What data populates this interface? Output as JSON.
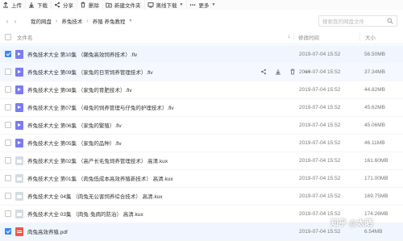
{
  "toolbar": {
    "items": [
      {
        "label": "上传",
        "icon": "upload-icon"
      },
      {
        "label": "下载",
        "icon": "download-icon"
      },
      {
        "label": "分享",
        "icon": "share-icon"
      },
      {
        "label": "删除",
        "icon": "delete-icon"
      },
      {
        "label": "新建文件夹",
        "icon": "new-folder-icon"
      },
      {
        "label": "离线下载",
        "icon": "offline-download-icon"
      },
      {
        "label": "更多",
        "icon": "more-icon"
      }
    ]
  },
  "breadcrumb": {
    "items": [
      "我的网盘",
      "养兔技术",
      "养殖 养兔教程"
    ]
  },
  "search": {
    "placeholder": "搜索我的网盘文件"
  },
  "columns": {
    "name": "文件名",
    "time": "修改时间",
    "size": "大小"
  },
  "files": [
    {
      "name": "养兔技术大全 第10集 （獭兔高效饲养技术）.flv",
      "time": "2019-07-04 15:52",
      "size": "56.50MB",
      "type": "flv",
      "checked": true
    },
    {
      "name": "养兔技术大全 第09集 （家兔的日常饲养管理技术）.flv",
      "time": "2019-07-04 15:52",
      "size": "37.34MB",
      "type": "flv",
      "checked": false
    },
    {
      "name": "养兔技术大全 第08集 （家兔的育肥技术）.flv",
      "time": "2019-07-04 15:52",
      "size": "44.82MB",
      "type": "flv",
      "checked": false
    },
    {
      "name": "养兔技术大全 第07集 （母兔的饲养管理与仔兔的护理技术）.flv",
      "time": "2019-07-04 15:52",
      "size": "45.62MB",
      "type": "flv",
      "checked": false
    },
    {
      "name": "养兔技术大全 第06集 （家兔的繁殖）.flv",
      "time": "2019-07-04 15:52",
      "size": "45.06MB",
      "type": "flv",
      "checked": false
    },
    {
      "name": "养兔技术大全 第05集 （家兔的品种）.flv",
      "time": "2019-07-04 15:52",
      "size": "46.11MB",
      "type": "flv",
      "checked": false
    },
    {
      "name": "养兔技术大全 第02集 （高产长毛兔饲养管理技术） 高清.kux",
      "time": "2019-07-04 15:52",
      "size": "161.60MB",
      "type": "kux",
      "checked": false
    },
    {
      "name": "养兔技术大全 第01集 （肉兔低成本高效养殖新技术） 高清.kux",
      "time": "2019-07-04 15:52",
      "size": "171.00MB",
      "type": "kux",
      "checked": false
    },
    {
      "name": "养兔技术大全 04集 （肉兔无公害饲养综合技术） 高清.kux",
      "time": "2019-07-04 15:52",
      "size": "169.75MB",
      "type": "kux",
      "checked": false
    },
    {
      "name": "养兔技术大全 03集 （肉兔·兔病的防治） 高清.kux",
      "time": "2019-07-04 15:52",
      "size": "174.26MB",
      "type": "kux",
      "checked": false
    },
    {
      "name": "肉兔高效养殖.pdf",
      "time": "2019-07-04 15:52",
      "size": "6.54MB",
      "type": "pdf",
      "checked": true
    }
  ],
  "watermark": "知乎 @太晒"
}
